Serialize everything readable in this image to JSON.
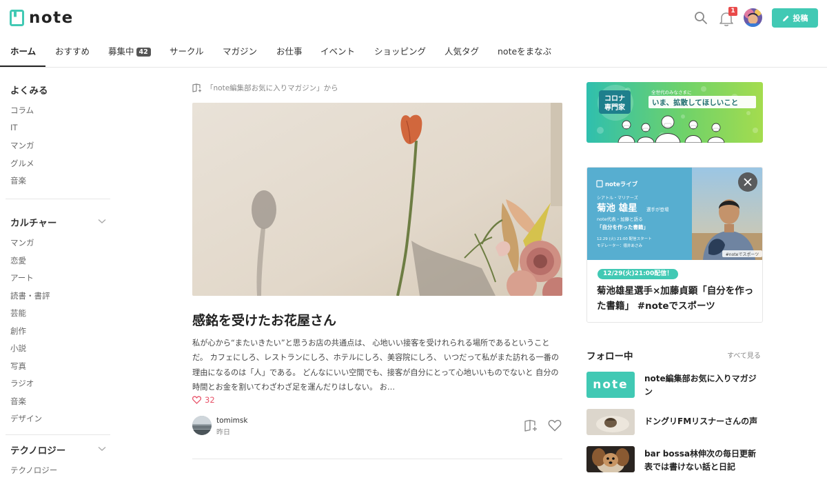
{
  "header": {
    "logo_text": "note",
    "notification_count": "1",
    "post_label": "投稿",
    "icons": [
      "note-logo-icon",
      "search-icon",
      "bell-icon",
      "avatar",
      "pen-icon"
    ]
  },
  "nav": {
    "items": [
      {
        "label": "ホーム",
        "active": true
      },
      {
        "label": "おすすめ"
      },
      {
        "label": "募集中",
        "badge": "42"
      },
      {
        "label": "サークル"
      },
      {
        "label": "マガジン"
      },
      {
        "label": "お仕事"
      },
      {
        "label": "イベント"
      },
      {
        "label": "ショッピング"
      },
      {
        "label": "人気タグ"
      },
      {
        "label": "noteをまなぶ"
      }
    ]
  },
  "sidebar": {
    "sections": [
      {
        "title": "よくみる",
        "items": [
          "コラム",
          "IT",
          "マンガ",
          "グルメ",
          "音楽"
        ]
      },
      {
        "title": "カルチャー",
        "items": [
          "マンガ",
          "恋愛",
          "アート",
          "読書・書評",
          "芸能",
          "創作",
          "小説",
          "写真",
          "ラジオ",
          "音楽",
          "デザイン"
        ]
      },
      {
        "title": "テクノロジー",
        "items": [
          "テクノロジー"
        ]
      }
    ]
  },
  "article": {
    "magazine_from": "「note編集部お気に入りマガジン」から",
    "title": "感銘を受けたお花屋さん",
    "body": "私が心から“またいきたい”と思うお店の共通点は、 心地いい接客を受けれられる場所であるということだ。 カフェにしろ、レストランにしろ、ホテルにしろ、美容院にしろ、 いつだって私がまた訪れる一番の理由になるのは「人」である。 どんなにいい空間でも、接客が自分にとって心地いいものでないと 自分の時間とお金を割いてわざわざ足を運んだりはしない。 お…",
    "likes": "32",
    "author": "tomimsk",
    "date": "昨日"
  },
  "banner": {
    "badge_line1": "コロナ",
    "badge_line2": "専門家",
    "subtitle": "全世代のみなさまに",
    "headline": "いま、拡散してほしいこと"
  },
  "live": {
    "brand": "noteライブ",
    "team": "シアトル・マリナーズ",
    "player": "菊池 雄星",
    "player_suffix": "選手が登場",
    "line1": "note代表・加藤と語る",
    "line2": "「自分を作った書籍」",
    "schedule": "12.29 (火) 21:00 配信スタート",
    "moderator": "モデレーター：徳井あさみ",
    "hashtag": "#noteでスポーツ",
    "tag": "12/29(火)21:00配信！",
    "title": "菊池雄星選手×加藤貞顕「自分を作った書籍」 #noteでスポーツ"
  },
  "follow": {
    "title": "フォロー中",
    "see_all": "すべて見る",
    "items": [
      {
        "name": "note編集部お気に入りマガジン",
        "thumb_text": "note"
      },
      {
        "name": "ドングリFMリスナーさんの声"
      },
      {
        "name": "bar bossa林伸次の毎日更新表では書けない話と日記"
      }
    ]
  },
  "colors": {
    "accent": "#41c9b4",
    "like": "#e8546a",
    "badge": "#e94a4a"
  }
}
